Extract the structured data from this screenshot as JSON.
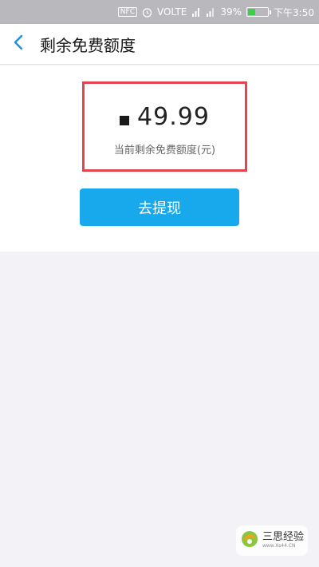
{
  "status_bar": {
    "nfc": "NFC",
    "network": "VOLTE",
    "battery_percent": "39%",
    "battery_level": 0.39,
    "time": "下午3:50"
  },
  "header": {
    "title": "剩余免费额度",
    "back_icon": "chevron-left-icon"
  },
  "quota": {
    "amount": "49.99",
    "label": "当前剩余免费额度(元)"
  },
  "actions": {
    "withdraw_label": "去提现"
  },
  "watermark": {
    "title": "三思经验",
    "url": "www.Xs44.CN"
  },
  "colors": {
    "accent": "#18a9ed",
    "highlight_border": "#e2454f",
    "status_bar": "#b9b9bd",
    "battery": "#3ccf4e"
  }
}
